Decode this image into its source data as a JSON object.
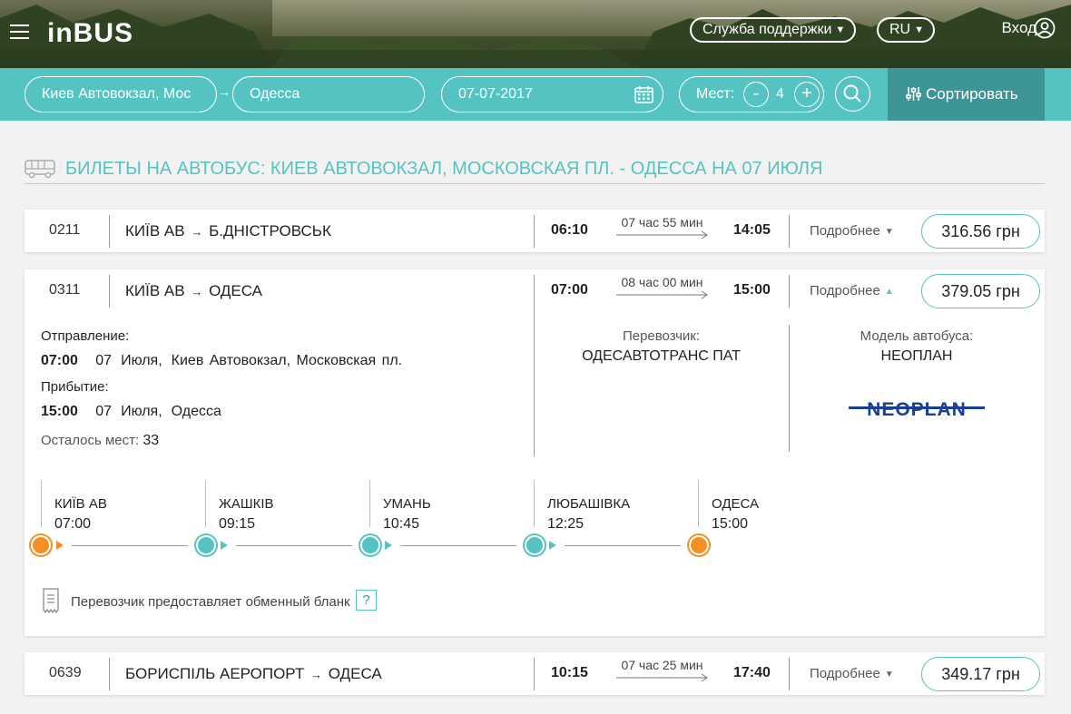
{
  "header": {
    "logo": "inBUS",
    "support_label": "Служба поддержки",
    "language": "RU",
    "login_label": "Вход"
  },
  "search": {
    "from": "Киев Автовокзал, Мос",
    "to": "Одесса",
    "date": "07-07-2017",
    "seats_label": "Мест:",
    "seats_count": "4",
    "minus_label": "-",
    "plus_label": "+",
    "sort_label": "Сортировать"
  },
  "page_title": "БИЛЕТЫ НА АВТОБУС: КИЕВ АВТОВОКЗАЛ, МОСКОВСКАЯ ПЛ. - ОДЕССА НА 07 ИЮЛЯ",
  "trips": [
    {
      "code": "0211",
      "route_from": "КИЇВ АВ",
      "route_to": "Б.ДНІСТРОВСЬК",
      "departure": "06:10",
      "duration": "07 час 55 мин",
      "arrival": "14:05",
      "more_label": "Подробнее",
      "price": "316.56 грн"
    },
    {
      "code": "0311",
      "route_from": "КИЇВ АВ",
      "route_to": "ОДЕСА",
      "departure": "07:00",
      "duration": "08 час 00 мин",
      "arrival": "15:00",
      "more_label": "Подробнее",
      "price": "379.05 грн",
      "details": {
        "departure_label": "Отправление:",
        "departure_time": "07:00",
        "departure_day": "07",
        "departure_month": "Июля,",
        "departure_place": "Киев Автовокзал, Московская пл.",
        "arrival_label": "Прибытие:",
        "arrival_time": "15:00",
        "arrival_day": "07",
        "arrival_month": "Июля,",
        "arrival_place": "Одесса",
        "seats_left_label": "Осталось мест:",
        "seats_left": "33",
        "carrier_label": "Перевозчик:",
        "carrier": "ОДЕСАВТОТРАНС ПАТ",
        "bus_model_label": "Модель автобуса:",
        "bus_model": "НЕОПЛАН",
        "bus_brand_logo": "NEOPLAN",
        "stops": [
          {
            "name": "КИЇВ АВ",
            "time": "07:00"
          },
          {
            "name": "ЖАШКІВ",
            "time": "09:15"
          },
          {
            "name": "УМАНЬ",
            "time": "10:45"
          },
          {
            "name": "ЛЮБАШІВКА",
            "time": "12:25"
          },
          {
            "name": "ОДЕСА",
            "time": "15:00"
          }
        ],
        "exchange_note": "Перевозчик предоставляет обменный бланк",
        "help_label": "?"
      }
    },
    {
      "code": "0639",
      "route_from": "БОРИСПІЛЬ АЕРОПОРТ",
      "route_to": "ОДЕСА",
      "departure": "10:15",
      "duration": "07 час 25 мин",
      "arrival": "17:40",
      "more_label": "Подробнее",
      "price": "349.17 грн"
    }
  ],
  "colors": {
    "accent": "#56c3c3",
    "accent_dark": "#3d9596",
    "stop_endpoint": "#f39022",
    "neoplan_blue": "#1c3f96"
  },
  "icons": [
    "hamburger-icon",
    "user-icon",
    "calendar-icon",
    "search-icon",
    "sliders-icon",
    "bus-icon",
    "document-icon"
  ]
}
